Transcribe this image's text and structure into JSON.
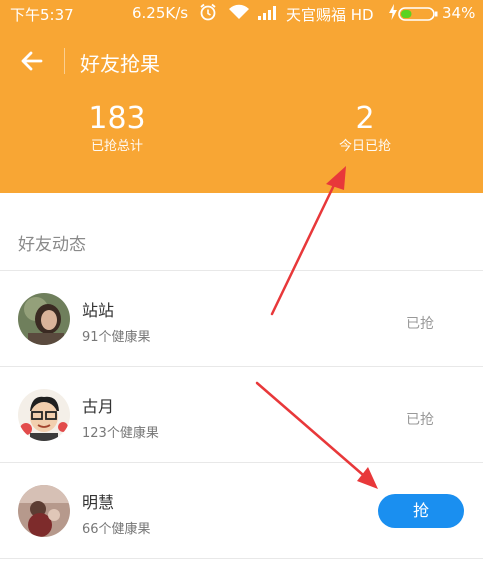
{
  "status_bar": {
    "time": "下午5:37",
    "speed": "6.25K/s",
    "carrier": "天官赐福 HD",
    "battery_pct": "34%",
    "battery_level": 0.34
  },
  "header": {
    "title": "好友抢果",
    "stats": {
      "total_value": "183",
      "total_label": "已抢总计",
      "today_value": "2",
      "today_label": "今日已抢"
    }
  },
  "friends": {
    "section_title": "好友动态",
    "items": [
      {
        "name": "站站",
        "fruits": "91个健康果",
        "status": "已抢"
      },
      {
        "name": "古月",
        "fruits": "123个健康果",
        "status": "已抢"
      },
      {
        "name": "明慧",
        "fruits": "66个健康果",
        "action": "抢"
      }
    ]
  },
  "colors": {
    "header_bg": "#f8a634",
    "action_blue": "#1a8ff0",
    "annotation_red": "#e8383a"
  },
  "icons": [
    "back-arrow-icon",
    "alarm-icon",
    "wifi-icon",
    "signal-icon",
    "charging-bolt-icon",
    "battery-icon"
  ]
}
